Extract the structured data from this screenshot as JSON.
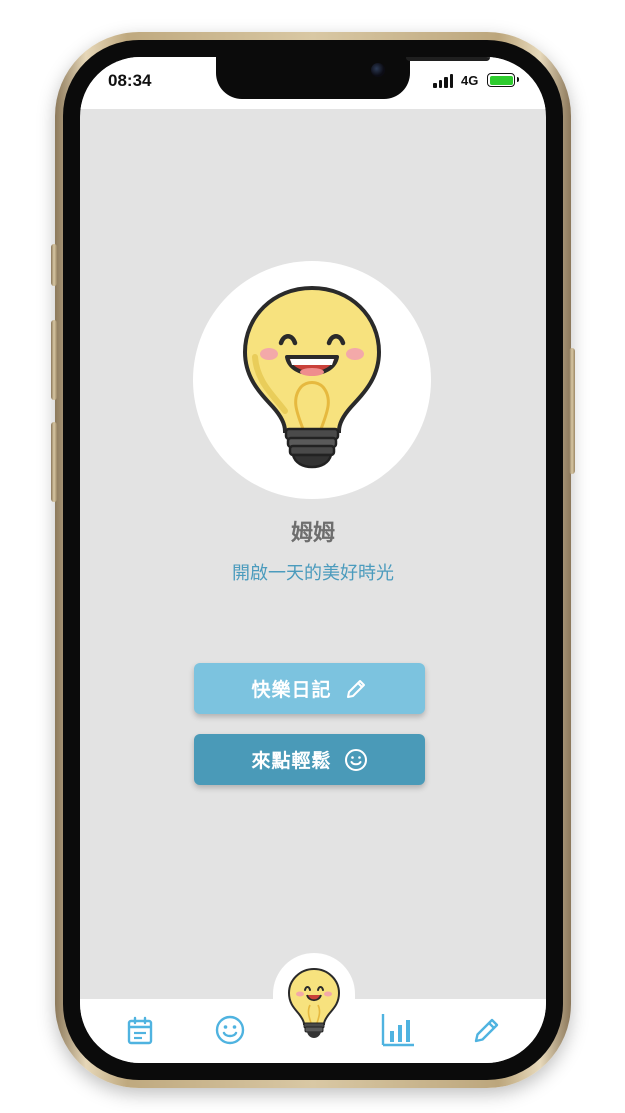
{
  "status_bar": {
    "time": "08:34",
    "network": "4G",
    "battery_color": "#2ecc2e"
  },
  "profile": {
    "avatar_icon": "lightbulb-mascot-icon",
    "name": "姆姆",
    "tagline": "開啟一天的美好時光"
  },
  "actions": {
    "diary_label": "快樂日記",
    "diary_icon": "pencil-icon",
    "relax_label": "來點輕鬆",
    "relax_icon": "smiley-icon"
  },
  "tab_bar": {
    "items": [
      {
        "icon": "calendar-icon"
      },
      {
        "icon": "smiley-icon"
      },
      {
        "icon": "lightbulb-mascot-icon"
      },
      {
        "icon": "bar-chart-icon"
      },
      {
        "icon": "pencil-icon"
      }
    ],
    "icon_color": "#4fb3e0"
  },
  "colors": {
    "background": "#e3e3e3",
    "diary_button": "#7cc3df",
    "relax_button": "#4a9ab8",
    "tagline": "#4b9bbd"
  }
}
